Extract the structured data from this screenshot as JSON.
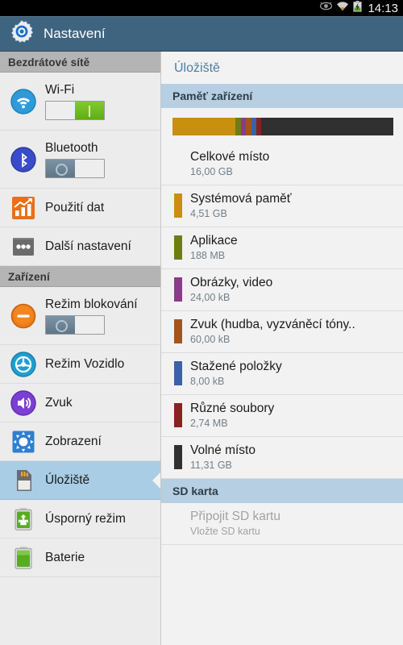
{
  "statusbar": {
    "icons": [
      "smart-stay-eye-icon",
      "wifi-icon",
      "battery-charging-icon"
    ],
    "clock": "14:13"
  },
  "actionbar": {
    "icon": "settings-gear-icon",
    "title": "Nastavení"
  },
  "sidebar": {
    "sections": [
      {
        "header": "Bezdrátové sítě",
        "items": [
          {
            "label": "Wi-Fi",
            "icon": "wifi-icon",
            "toggle": "on",
            "selected": false
          },
          {
            "label": "Bluetooth",
            "icon": "bluetooth-icon",
            "toggle": "off",
            "selected": false
          },
          {
            "label": "Použití dat",
            "icon": "data-usage-icon",
            "toggle": null,
            "selected": false
          },
          {
            "label": "Další nastavení",
            "icon": "more-dots-icon",
            "toggle": null,
            "selected": false
          }
        ]
      },
      {
        "header": "Zařízení",
        "items": [
          {
            "label": "Režim blokování",
            "icon": "blocking-mode-icon",
            "toggle": "off",
            "selected": false
          },
          {
            "label": "Režim Vozidlo",
            "icon": "car-mode-icon",
            "toggle": null,
            "selected": false
          },
          {
            "label": "Zvuk",
            "icon": "sound-speaker-icon",
            "toggle": null,
            "selected": false
          },
          {
            "label": "Zobrazení",
            "icon": "display-brightness-icon",
            "toggle": null,
            "selected": false
          },
          {
            "label": "Úložiště",
            "icon": "sd-card-icon",
            "toggle": null,
            "selected": true
          },
          {
            "label": "Úsporný režim",
            "icon": "power-saving-icon",
            "toggle": null,
            "selected": false
          },
          {
            "label": "Baterie",
            "icon": "battery-icon",
            "toggle": null,
            "selected": false
          }
        ]
      }
    ]
  },
  "panel": {
    "title": "Úložiště",
    "device_header": "Paměť zařízení",
    "total": {
      "title": "Celkové místo",
      "value": "16,00 GB"
    },
    "categories": [
      {
        "title": "Systémová paměť",
        "value": "4,51 GB",
        "color": "#c8900d"
      },
      {
        "title": "Aplikace",
        "value": "188 MB",
        "color": "#6e7d15"
      },
      {
        "title": "Obrázky, video",
        "value": "24,00 kB",
        "color": "#8c3a8c"
      },
      {
        "title": "Zvuk (hudba, vyzváněcí tóny..",
        "value": "60,00 kB",
        "color": "#a0561f"
      },
      {
        "title": "Stažené položky",
        "value": "8,00 kB",
        "color": "#3a62a5"
      },
      {
        "title": "Různé soubory",
        "value": "2,74 MB",
        "color": "#8b2020"
      },
      {
        "title": "Volné místo",
        "value": "11,31 GB",
        "color": "#303030"
      }
    ],
    "sd_header": "SD karta",
    "sd_action": {
      "title": "Připojit SD kartu",
      "subtitle": "Vložte SD kartu"
    }
  },
  "chart_data": {
    "type": "bar",
    "title": "Paměť zařízení",
    "categories": [
      "Systémová paměť",
      "Aplikace",
      "Obrázky, video",
      "Zvuk (hudba, vyzváněcí tóny..",
      "Stažené položky",
      "Různé soubory",
      "Volné místo"
    ],
    "values": [
      4.51,
      0.1836,
      2.29e-05,
      5.72e-05,
      7.6e-06,
      0.00268,
      11.31
    ],
    "value_labels": [
      "4,51 GB",
      "188 MB",
      "24,00 kB",
      "60,00 kB",
      "8,00 kB",
      "2,74 MB",
      "11,31 GB"
    ],
    "colors": [
      "#c8900d",
      "#6e7d15",
      "#8c3a8c",
      "#a0561f",
      "#3a62a5",
      "#8b2020",
      "#303030"
    ],
    "segment_widths_pct": [
      28.5,
      2.6,
      2.3,
      2.3,
      2.3,
      2.3,
      59.7
    ],
    "total": 16.0,
    "unit": "GB",
    "ylabel": "",
    "xlabel": "",
    "legend": "right-list"
  }
}
